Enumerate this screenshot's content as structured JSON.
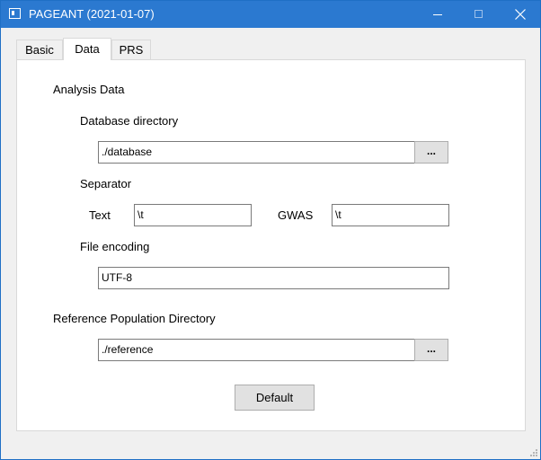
{
  "window": {
    "title": "PAGEANT (2021-01-07)"
  },
  "tabs": [
    {
      "label": "Basic"
    },
    {
      "label": "Data"
    },
    {
      "label": "PRS"
    }
  ],
  "data_tab": {
    "analysis_heading": "Analysis Data",
    "database_dir_label": "Database directory",
    "database_dir_value": "./database",
    "database_browse_label": "...",
    "separator_label": "Separator",
    "text_sep_label": "Text",
    "text_sep_value": "\\t",
    "gwas_sep_label": "GWAS",
    "gwas_sep_value": "\\t",
    "encoding_label": "File encoding",
    "encoding_value": "UTF-8",
    "reference_label": "Reference Population Directory",
    "reference_value": "./reference",
    "reference_browse_label": "...",
    "default_button_label": "Default"
  }
}
